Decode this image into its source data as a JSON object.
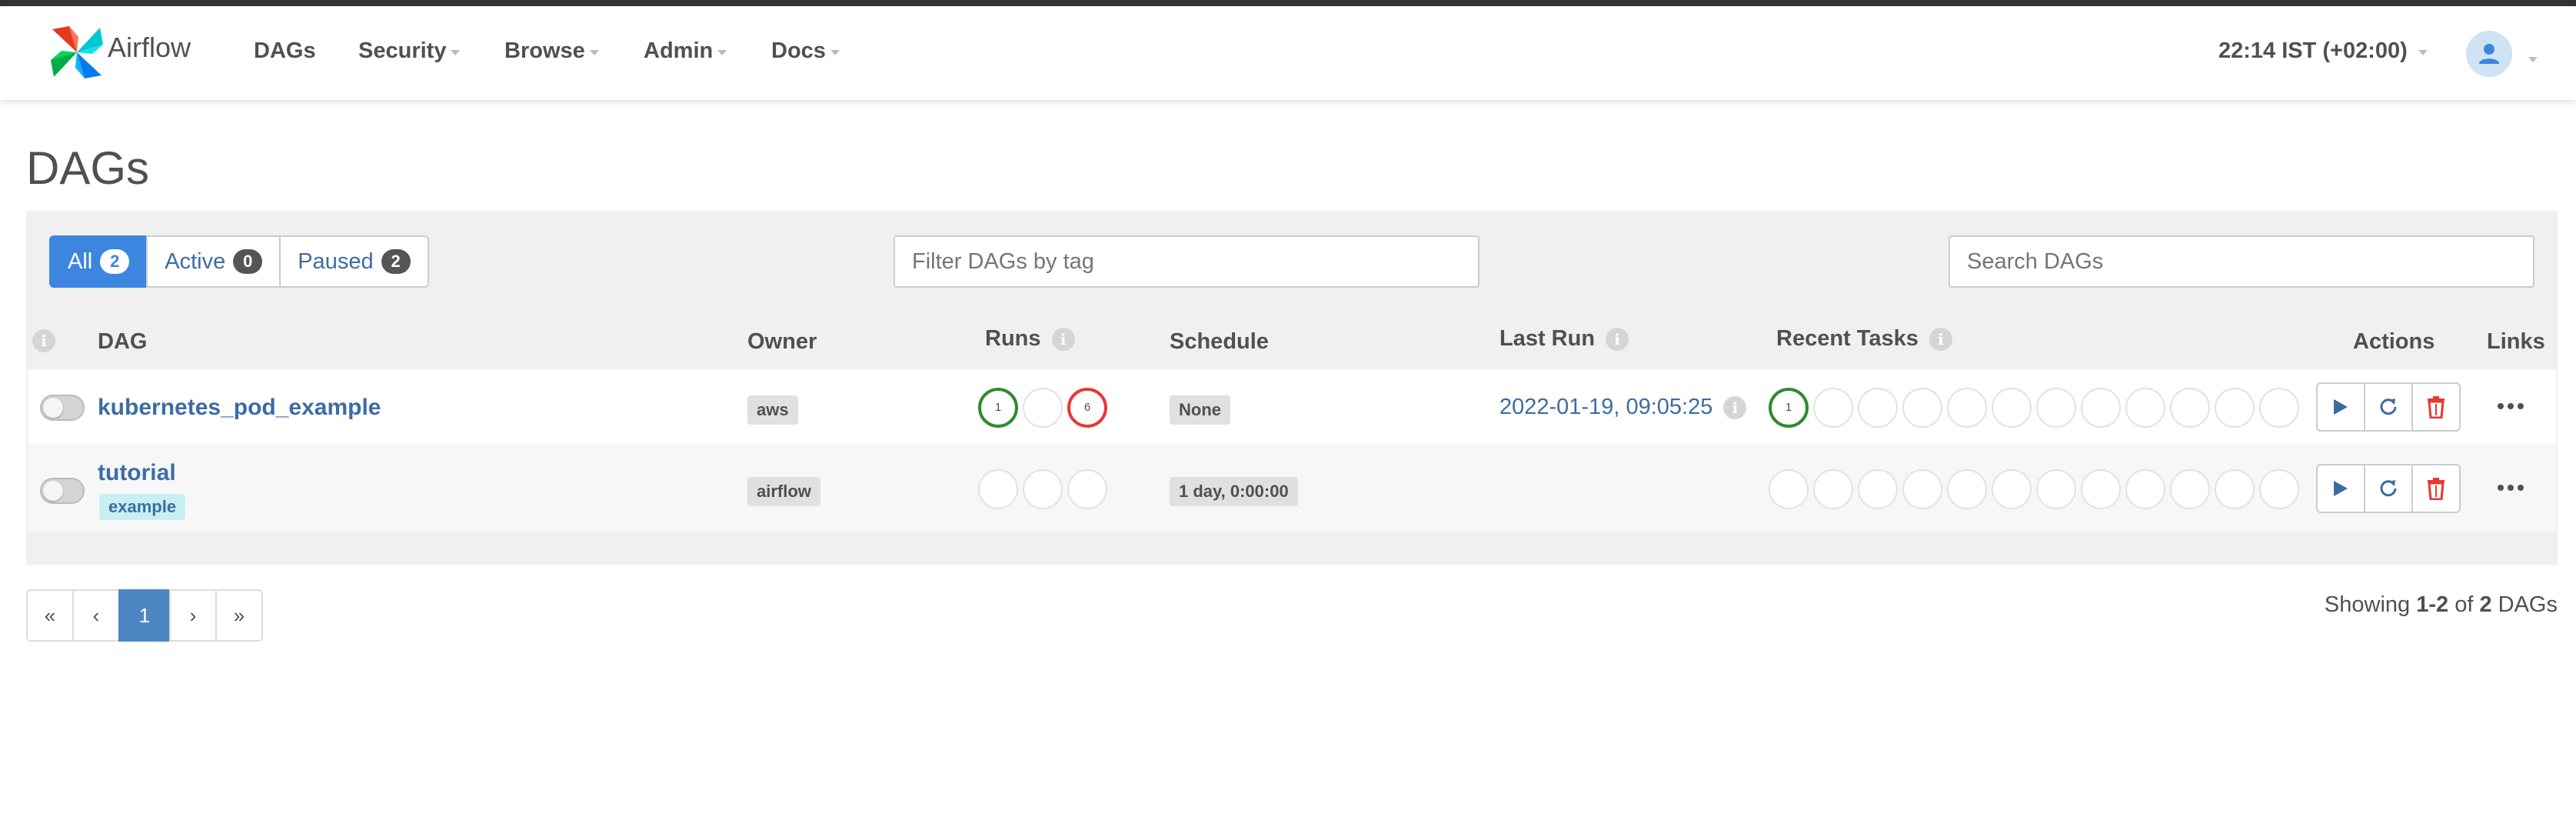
{
  "navbar": {
    "brand": "Airflow",
    "items": [
      {
        "label": "DAGs",
        "has_menu": false
      },
      {
        "label": "Security",
        "has_menu": true
      },
      {
        "label": "Browse",
        "has_menu": true
      },
      {
        "label": "Admin",
        "has_menu": true
      },
      {
        "label": "Docs",
        "has_menu": true
      }
    ],
    "time": "22:14 IST (+02:00)",
    "user_icon": "user-icon"
  },
  "page_title": "DAGs",
  "filters": {
    "all": {
      "label": "All",
      "count": "2"
    },
    "active": {
      "label": "Active",
      "count": "0"
    },
    "paused": {
      "label": "Paused",
      "count": "2"
    }
  },
  "tag_filter_placeholder": "Filter DAGs by tag",
  "search_placeholder": "Search DAGs",
  "columns": {
    "dag": "DAG",
    "owner": "Owner",
    "runs": "Runs",
    "schedule": "Schedule",
    "last_run": "Last Run",
    "recent_tasks": "Recent Tasks",
    "actions": "Actions",
    "links": "Links"
  },
  "info_icon_glyph": "i",
  "dags": [
    {
      "name": "kubernetes_pod_example",
      "tags": [],
      "owner": "aws",
      "runs": [
        {
          "state": "success",
          "count": "1"
        },
        {
          "state": "running",
          "count": ""
        },
        {
          "state": "failed",
          "count": "6"
        }
      ],
      "schedule": "None",
      "last_run": "2022-01-19, 09:05:25",
      "recent_tasks": [
        {
          "state": "success",
          "count": "1"
        }
      ]
    },
    {
      "name": "tutorial",
      "tags": [
        "example"
      ],
      "owner": "airflow",
      "runs": [],
      "schedule": "1 day, 0:00:00",
      "last_run": "",
      "recent_tasks": []
    }
  ],
  "pagination": {
    "first": "«",
    "prev": "‹",
    "current": "1",
    "next": "›",
    "last": "»"
  },
  "showing": {
    "prefix": "Showing ",
    "range": "1-2",
    "of": " of ",
    "total": "2",
    "suffix": " DAGs"
  },
  "colors": {
    "success": "#2e8b2e",
    "failed": "#e43a30",
    "primary": "#3c86e0",
    "link": "#3d6ca3"
  }
}
